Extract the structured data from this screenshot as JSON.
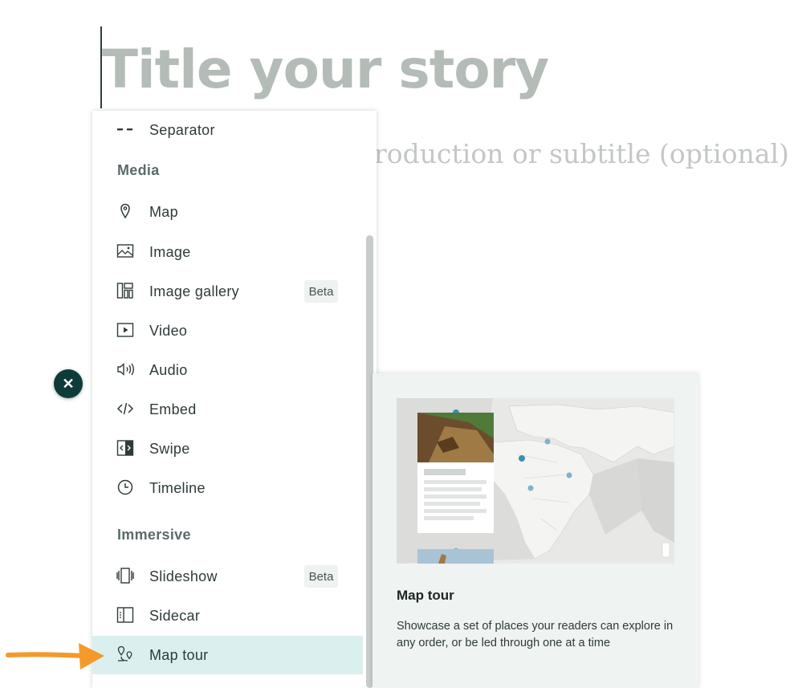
{
  "story": {
    "title": "Title your story",
    "subtitle": "roduction or subtitle (optional)"
  },
  "close_button": {
    "icon": "close-icon",
    "glyph": "✕"
  },
  "menu": {
    "top_item": {
      "label": "Separator",
      "icon": "separator-icon"
    },
    "sections": [
      {
        "heading": "Media",
        "items": [
          {
            "label": "Map",
            "icon": "map-pin-icon",
            "badge": ""
          },
          {
            "label": "Image",
            "icon": "image-icon",
            "badge": ""
          },
          {
            "label": "Image gallery",
            "icon": "gallery-icon",
            "badge": "Beta"
          },
          {
            "label": "Video",
            "icon": "video-icon",
            "badge": ""
          },
          {
            "label": "Audio",
            "icon": "audio-icon",
            "badge": ""
          },
          {
            "label": "Embed",
            "icon": "embed-icon",
            "badge": ""
          },
          {
            "label": "Swipe",
            "icon": "swipe-icon",
            "badge": ""
          },
          {
            "label": "Timeline",
            "icon": "timeline-icon",
            "badge": ""
          }
        ]
      },
      {
        "heading": "Immersive",
        "items": [
          {
            "label": "Slideshow",
            "icon": "slideshow-icon",
            "badge": "Beta"
          },
          {
            "label": "Sidecar",
            "icon": "sidecar-icon",
            "badge": ""
          },
          {
            "label": "Map tour",
            "icon": "map-tour-icon",
            "badge": "",
            "active": true
          }
        ]
      }
    ]
  },
  "preview": {
    "title": "Map tour",
    "description": "Showcase a set of places your readers can explore in any order, or be led through one at a time"
  },
  "colors": {
    "accent_dark": "#0d3b3a",
    "active_bg": "#dbefee",
    "arrow": "#f39a2b"
  }
}
